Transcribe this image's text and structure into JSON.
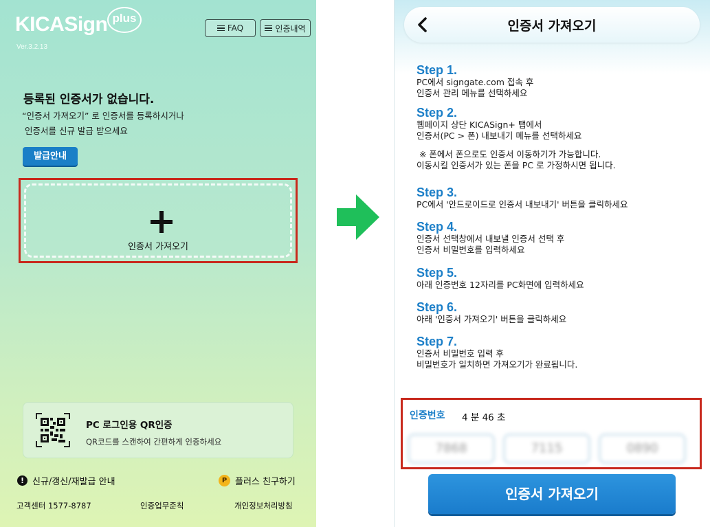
{
  "left_screen": {
    "logo_text": "KICASign",
    "logo_badge": "plus",
    "version": "Ver.3.2.13",
    "faq_label": "FAQ",
    "history_label": "인증내역",
    "empty_title": "등록된 인증서가 없습니다.",
    "empty_desc_line1": "“인증서 가져오기” 로 인증서를 등록하시거나",
    "empty_desc_line2": " 인증서를 신규 발급 받으세요",
    "issue_guide_label": "발급안내",
    "import_label": "인증서 가져오기",
    "qr_title": "PC 로그인용 QR인증",
    "qr_subtitle": "QR코드를 스캔하여 간편하게 인증하세요",
    "renew_label": "신규/갱신/재발급 안내",
    "friend_label": "플러스 친구하기",
    "cs_center": "고객센터 1577-8787",
    "work_rules": "인증업무준칙",
    "privacy": "개인정보처리방침"
  },
  "right_screen": {
    "title": "인증서 가져오기",
    "steps": [
      {
        "title": "Step 1.",
        "lines": [
          "PC에서 signgate.com 접속 후",
          "인증서 관리 메뉴를 선택하세요"
        ]
      },
      {
        "title": "Step 2.",
        "lines": [
          "웹페이지 상단 KICASign+ 탭에서",
          "인증서(PC > 폰) 내보내기 메뉴를 선택하세요",
          "",
          " ※ 폰에서 폰으로도 인증서 이동하기가 가능합니다.",
          "이동시킬 인증서가 있는 폰을 PC 로 가정하시면 됩니다."
        ]
      },
      {
        "title": "Step 3.",
        "lines": [
          "PC에서 '안드로이드로 인증서 내보내기' 버튼을 클릭하세요"
        ]
      },
      {
        "title": "Step 4.",
        "lines": [
          "인증서 선택창에서 내보낼 인증서 선택 후",
          "인증서 비밀번호를 입력하세요"
        ]
      },
      {
        "title": "Step 5.",
        "lines": [
          "아래 인증번호 12자리를 PC화면에 입력하세요"
        ]
      },
      {
        "title": "Step 6.",
        "lines": [
          "아래 '인증서 가져오기' 버튼을 클릭하세요"
        ]
      },
      {
        "title": "Step 7.",
        "lines": [
          "인증서 비밀번호 입력 후",
          "비밀번호가 일치하면 가져오기가 완료됩니다."
        ]
      }
    ],
    "code_label": "인증번호",
    "timer": "4 분 46 초",
    "code_1": "7868",
    "code_2": "7115",
    "code_3": "0890",
    "import_button_label": "인증서 가져오기"
  },
  "colors": {
    "accent_blue": "#1c7fc8",
    "highlight_red": "#c8291d",
    "arrow_green": "#1fbf5a"
  },
  "icons": {
    "menu": "hamburger-icon",
    "plus": "plus-icon",
    "qr": "qr-code-icon",
    "alert": "exclamation-icon",
    "kakao_plus": "kakao-plus-friend-icon",
    "back": "chevron-left-icon",
    "arrow": "arrow-right-icon"
  }
}
